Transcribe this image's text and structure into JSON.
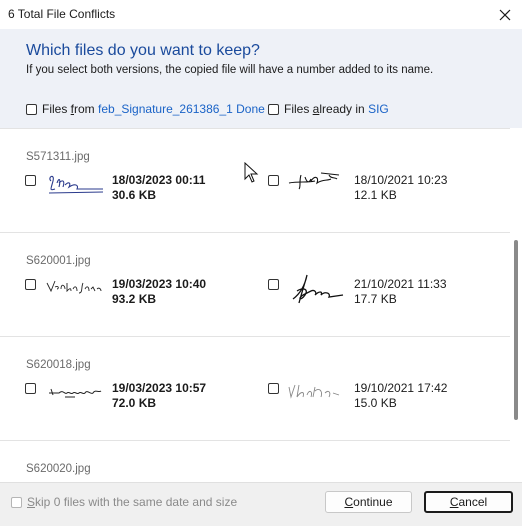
{
  "window": {
    "title": "6 Total File Conflicts",
    "close_icon": "close-icon"
  },
  "header": {
    "question": "Which files do you want to keep?",
    "hint": "If you select both versions, the copied file will have a number added to its name.",
    "source_check": {
      "prefix": "Files ",
      "accel": "f",
      "mid": "rom ",
      "link": "feb_Signature_261386_1 Done"
    },
    "dest_check": {
      "prefix": "Files ",
      "accel": "a",
      "mid": "lready in ",
      "link": "SIG"
    }
  },
  "conflicts": [
    {
      "name": "S571311.jpg",
      "left_date": "18/03/2023 00:11",
      "left_size": "30.6 KB",
      "right_date": "18/10/2021 10:23",
      "right_size": "12.1 KB"
    },
    {
      "name": "S620001.jpg",
      "left_date": "19/03/2023 10:40",
      "left_size": "93.2 KB",
      "right_date": "21/10/2021 11:33",
      "right_size": "17.7 KB"
    },
    {
      "name": "S620018.jpg",
      "left_date": "19/03/2023 10:57",
      "left_size": "72.0 KB",
      "right_date": "19/10/2021 17:42",
      "right_size": "15.0 KB"
    },
    {
      "name": "S620020.jpg"
    }
  ],
  "footer": {
    "skip": {
      "accel": "S",
      "rest": "kip 0 files with the same date and size"
    },
    "continue": {
      "accel": "C",
      "rest": "ontinue"
    },
    "cancel": {
      "accel": "C",
      "rest": "ancel"
    }
  },
  "colors": {
    "accent": "#1a63c7",
    "header_bg": "#eef1f7",
    "question": "#1a4a9c"
  }
}
